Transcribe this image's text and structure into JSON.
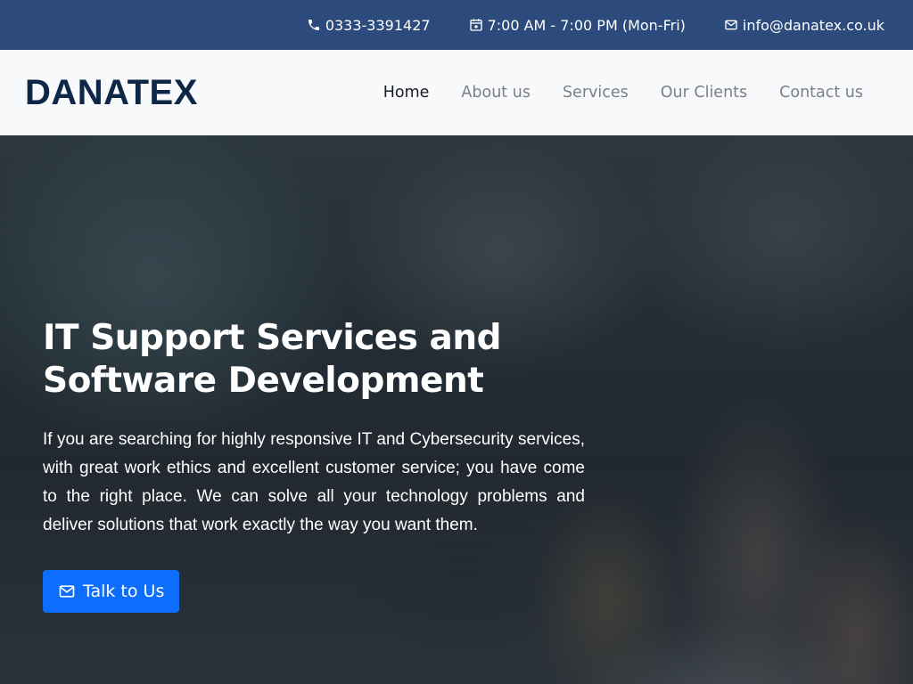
{
  "topbar": {
    "phone": {
      "icon": "phone-icon",
      "text": "0333-3391427"
    },
    "hours": {
      "icon": "calendar-plus-icon",
      "text": "7:00 AM - 7:00 PM (Mon-Fri)"
    },
    "email": {
      "icon": "envelope-icon",
      "text": "info@danatex.co.uk"
    }
  },
  "brand": {
    "logo": "DANATEX"
  },
  "nav": {
    "items": [
      {
        "label": "Home",
        "active": true
      },
      {
        "label": "About us"
      },
      {
        "label": "Services"
      },
      {
        "label": "Our Clients"
      },
      {
        "label": "Contact us"
      }
    ]
  },
  "hero": {
    "title_line1": "IT Support Services and",
    "title_line2": "Software Development",
    "text": "If you are searching for highly responsive IT and Cybersecurity services, with great work ethics and excellent customer service; you have come to the right place. We can solve all your technology problems and deliver solutions that work exactly the way you want them.",
    "cta": {
      "icon": "envelope-icon",
      "label": "Talk to Us"
    }
  },
  "colors": {
    "topbar_bg": "#2c4a7c",
    "navbar_bg": "#f8f9fb",
    "logo": "#0f2747",
    "nav_active": "#1a1d21",
    "nav_inactive": "#7b8087",
    "cta_bg": "#0d6efd"
  }
}
